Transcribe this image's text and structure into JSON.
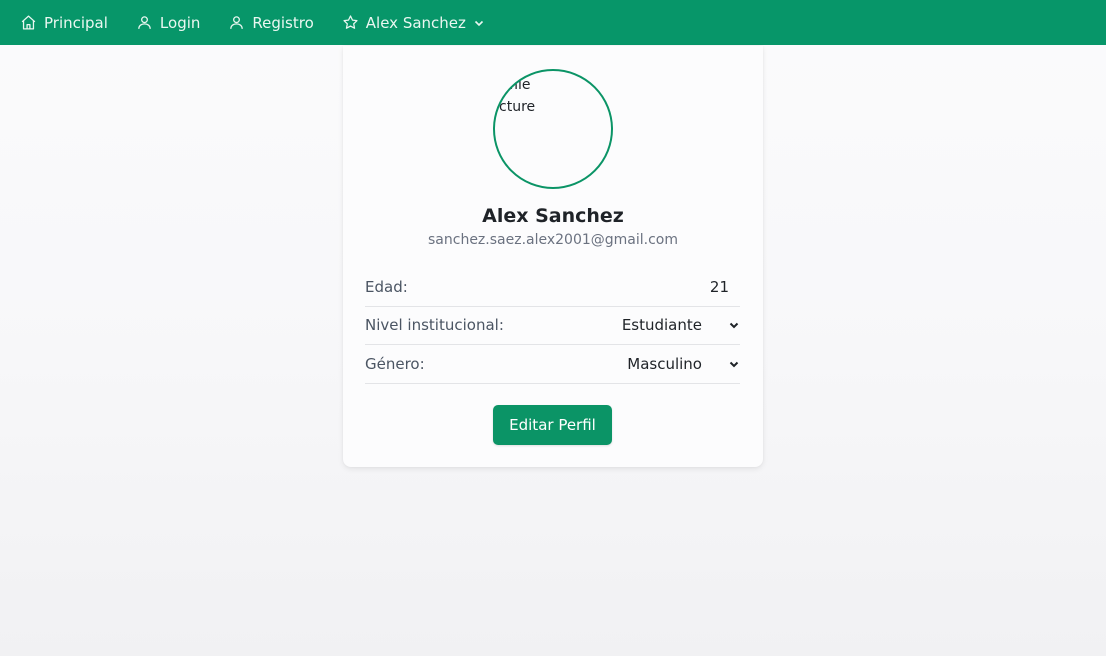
{
  "nav": {
    "items": [
      {
        "label": "Principal",
        "icon": "home-icon"
      },
      {
        "label": "Login",
        "icon": "user-icon"
      },
      {
        "label": "Registro",
        "icon": "user-icon"
      },
      {
        "label": "Alex Sanchez",
        "icon": "star-icon",
        "dropdown": true
      }
    ]
  },
  "profile": {
    "avatar_alt": "Profile Picture",
    "name": "Alex Sanchez",
    "email": "sanchez.saez.alex2001@gmail.com",
    "fields": {
      "age": {
        "label": "Edad:",
        "value": "21"
      },
      "level": {
        "label": "Nivel institucional:",
        "value": "Estudiante"
      },
      "gender": {
        "label": "Género:",
        "value": "Masculino"
      }
    },
    "edit_button": "Editar Perfil"
  },
  "colors": {
    "primary": "#079669",
    "background": "#f7f7f9",
    "card": "#fcfcfd",
    "muted_text": "#6b7280"
  }
}
